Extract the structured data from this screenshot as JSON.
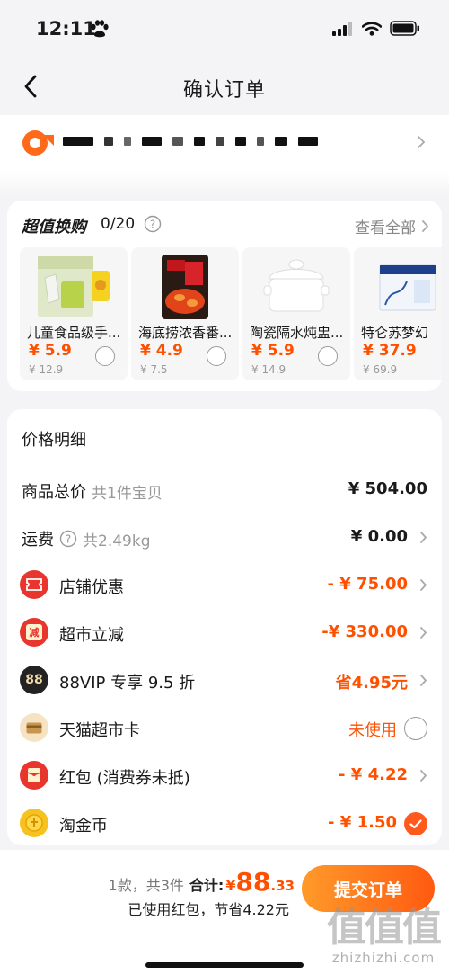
{
  "status": {
    "time": "12:11"
  },
  "nav": {
    "title": "确认订单"
  },
  "swap": {
    "title": "超值换购",
    "count": "0/20",
    "view_all": "查看全部",
    "products": [
      {
        "name": "儿童食品级手...",
        "price": "¥ 5.9",
        "orig": "¥ 12.9",
        "icon": "gloves-pack"
      },
      {
        "name": "海底捞浓香番...",
        "price": "¥ 4.9",
        "orig": "¥ 7.5",
        "icon": "sauce-pack"
      },
      {
        "name": "陶瓷隔水炖盅...",
        "price": "¥ 5.9",
        "orig": "¥ 14.9",
        "icon": "ceramic-pot"
      },
      {
        "name": "特仑苏梦幻",
        "price": "¥ 37.9",
        "orig": "¥ 69.9",
        "icon": "milk-box"
      }
    ]
  },
  "price": {
    "title": "价格明细",
    "rows": [
      {
        "label": "商品总价",
        "sub": "共1件宝贝",
        "value": "¥ 504.00"
      },
      {
        "label": "运费",
        "sub": "共2.49kg",
        "value": "¥ 0.00"
      },
      {
        "label": "店铺优惠",
        "value": "- ¥ 75.00"
      },
      {
        "label": "超市立减",
        "value": "-¥ 330.00",
        "icon_text": "减"
      },
      {
        "label": "88VIP 专享 9.5 折",
        "value": "省4.95元",
        "icon_text": "88"
      },
      {
        "label": "天猫超市卡",
        "value": "未使用"
      },
      {
        "label": "红包 (消费券未抵)",
        "value": "- ¥ 4.22"
      },
      {
        "label": "淘金币",
        "value": "- ¥ 1.50"
      }
    ]
  },
  "footer": {
    "count_text": "1款，共3件",
    "total_label": "合计:",
    "currency": "¥",
    "total_int": "88",
    "total_dec": ".33",
    "saving": "已使用红包，节省4.22元",
    "submit": "提交订单"
  },
  "watermark": {
    "glyphs": "值值值",
    "url": "zhizhizhi.com"
  },
  "colors": {
    "accent": "#ff5000",
    "badge_red": "#e8362f",
    "coin_yellow": "#f7c21d"
  }
}
